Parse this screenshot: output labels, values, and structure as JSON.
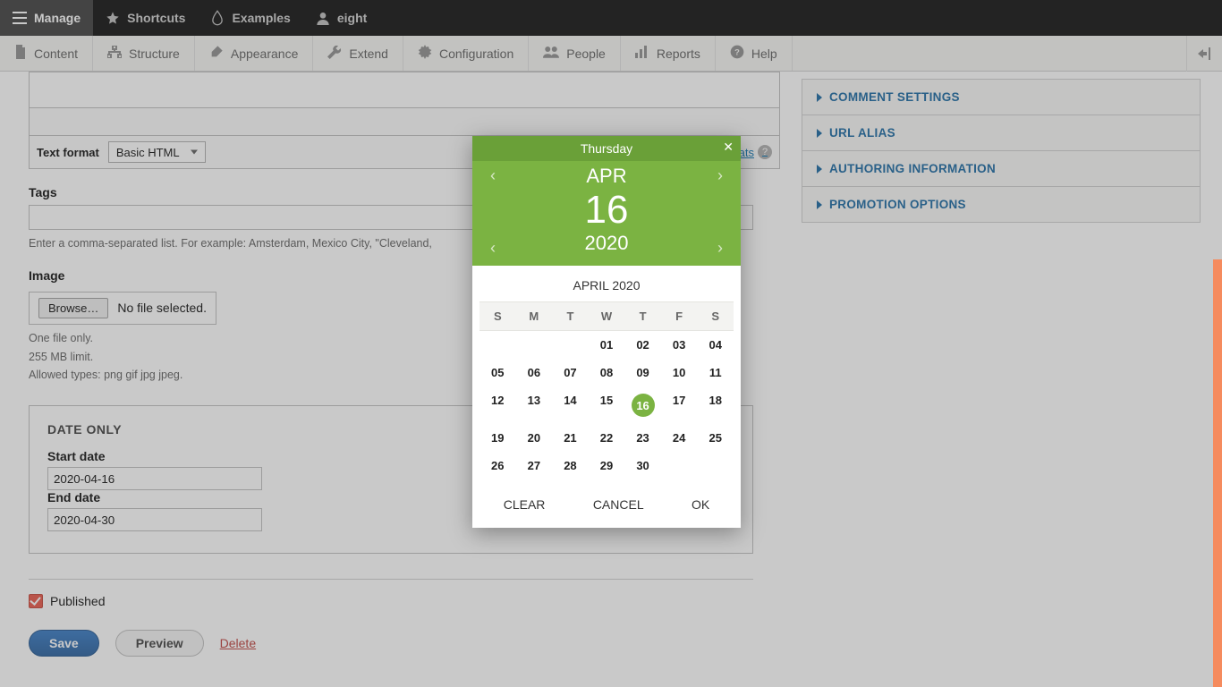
{
  "toolbar_top": {
    "manage": "Manage",
    "shortcuts": "Shortcuts",
    "examples": "Examples",
    "user": "eight"
  },
  "toolbar_sub": {
    "content": "Content",
    "structure": "Structure",
    "appearance": "Appearance",
    "extend": "Extend",
    "configuration": "Configuration",
    "people": "People",
    "reports": "Reports",
    "help": "Help"
  },
  "editor": {
    "format_label": "Text format",
    "format_value": "Basic HTML",
    "about_link": "About text formats"
  },
  "tags": {
    "label": "Tags",
    "help": "Enter a comma-separated list. For example: Amsterdam, Mexico City, \"Cleveland,"
  },
  "image": {
    "label": "Image",
    "browse": "Browse…",
    "nofile": "No file selected.",
    "help1": "One file only.",
    "help2": "255 MB limit.",
    "help3": "Allowed types: png gif jpg jpeg."
  },
  "date_fieldset": {
    "legend": "DATE ONLY",
    "start_label": "Start date",
    "start_value": "2020-04-16",
    "end_label": "End date",
    "end_value": "2020-04-30"
  },
  "published_label": "Published",
  "actions": {
    "save": "Save",
    "preview": "Preview",
    "delete": "Delete"
  },
  "sidebar": {
    "comment": "COMMENT SETTINGS",
    "url": "URL ALIAS",
    "authoring": "AUTHORING INFORMATION",
    "promotion": "PROMOTION OPTIONS"
  },
  "datepicker": {
    "weekday": "Thursday",
    "close": "✕",
    "month_abbr": "APR",
    "day": "16",
    "year": "2020",
    "title": "APRIL 2020",
    "dow": [
      "S",
      "M",
      "T",
      "W",
      "T",
      "F",
      "S"
    ],
    "leading_blanks": 3,
    "days": [
      "01",
      "02",
      "03",
      "04",
      "05",
      "06",
      "07",
      "08",
      "09",
      "10",
      "11",
      "12",
      "13",
      "14",
      "15",
      "16",
      "17",
      "18",
      "19",
      "20",
      "21",
      "22",
      "23",
      "24",
      "25",
      "26",
      "27",
      "28",
      "29",
      "30"
    ],
    "selected": "16",
    "clear": "CLEAR",
    "cancel": "CANCEL",
    "ok": "OK"
  }
}
